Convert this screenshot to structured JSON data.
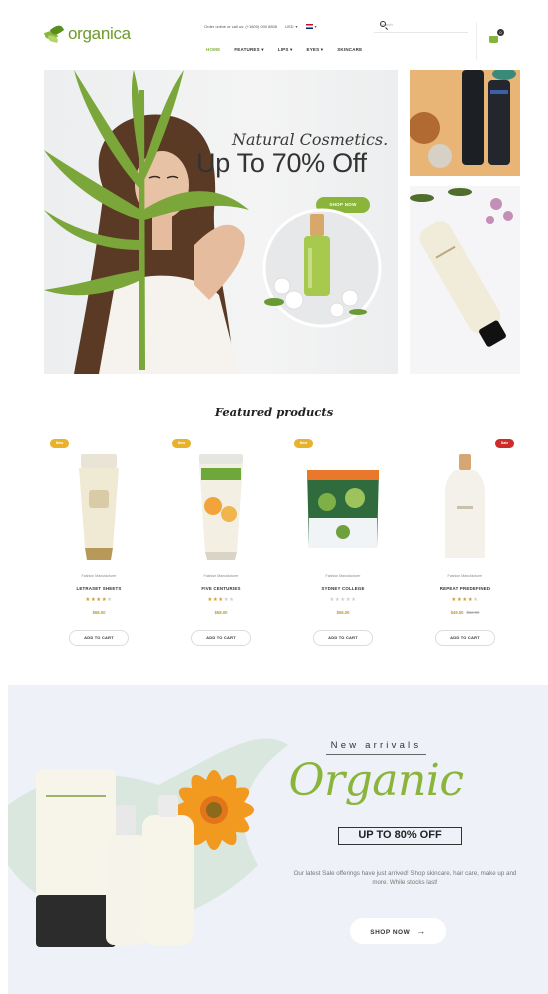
{
  "header": {
    "logo": "organica",
    "phone_text": "Order online or call us: (+1800) 000 8808",
    "currency": "USD",
    "search_placeholder": "Search",
    "cart_count": "0",
    "nav": [
      "HOME",
      "FEATURES",
      "LIPS",
      "EYES",
      "SKINCARE"
    ]
  },
  "hero": {
    "script": "Natural Cosmetics.",
    "title": "Up To 70% Off",
    "button": "SHOP NOW"
  },
  "featured": {
    "title": "Featured products",
    "add_to_cart": "ADD TO CART",
    "products": [
      {
        "badge": "New",
        "vendor": "Fashion Manufacturer",
        "name": "LETRASET SHEETS",
        "rating": 4,
        "price": "$68.00",
        "old_price": ""
      },
      {
        "badge": "New",
        "vendor": "Fashion Manufacturer",
        "name": "FIVE CENTURIES",
        "rating": 3,
        "price": "$58.00",
        "old_price": ""
      },
      {
        "badge": "New",
        "vendor": "Fashion Manufacturer",
        "name": "SYDNEY COLLEGE",
        "rating": 0,
        "price": "$56.00",
        "old_price": ""
      },
      {
        "badge": "Sale",
        "vendor": "Fashion Manufacturer",
        "name": "REPEAT PREDEFINED",
        "rating": 4,
        "price": "$49.00",
        "old_price": "$52.00"
      }
    ]
  },
  "arrivals": {
    "kicker": "New arrivals",
    "headline": "Organic",
    "offer": "UP TO 80% OFF",
    "text": "Our latest Sale offerings have just arrived! Shop skincare, hair care, make up and more. While stocks last!",
    "button": "SHOP NOW"
  },
  "colors": {
    "accent": "#8ab43a",
    "sale": "#cc2c2a",
    "new": "#e9b22d"
  }
}
